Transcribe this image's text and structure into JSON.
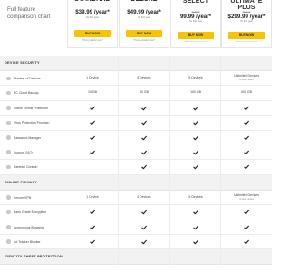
{
  "header": {
    "title_line1": "Full feature",
    "title_line2": "comparison chart"
  },
  "plans": [
    {
      "name": "STANDARD",
      "old_price": "",
      "price": "$39.99",
      "price_suffix": "/year*",
      "per": "for first year",
      "buy": "BUY NOW",
      "info": "*Pricing details below*",
      "name_faded": true
    },
    {
      "name": "DELUXE",
      "old_price": "",
      "price": "$49.99",
      "price_suffix": "/year*",
      "per": "for first year",
      "buy": "BUY NOW",
      "info": "*Pricing details below*",
      "name_faded": true
    },
    {
      "name": "SELECT",
      "old_price": "$149.99",
      "price": "99.99",
      "price_suffix": "/year*",
      "per": "for first year",
      "buy": "BUY NOW",
      "info": "*Pricing details below*",
      "name_faded": false
    },
    {
      "name": "ULTIMATE PLUS",
      "old_price": "$349.99",
      "price": "$299.99",
      "price_suffix": "/year*",
      "per": "for first year",
      "buy": "BUY NOW",
      "info": "*Pricing details below*",
      "name_faded": false
    }
  ],
  "sections": [
    {
      "label": "DEVICE SECURITY",
      "rows": [
        {
          "feature": "Number of Devices",
          "values": [
            "1 Device",
            "5 Devices",
            "5 Devices",
            "Unlimited Devices|Unless noted"
          ]
        },
        {
          "feature": "PC Cloud Backup",
          "values": [
            "10 GB",
            "50 GB",
            "100 GB",
            "500 GB"
          ]
        },
        {
          "feature": "Online Threat Protection",
          "values": [
            "check",
            "check",
            "check",
            "check"
          ]
        },
        {
          "feature": "Virus Protection Promise²",
          "values": [
            "check",
            "check",
            "check",
            "check"
          ]
        },
        {
          "feature": "Password Manager",
          "values": [
            "check",
            "check",
            "check",
            "check"
          ]
        },
        {
          "feature": "Support 24/7³",
          "values": [
            "check",
            "check",
            "check",
            "check"
          ]
        },
        {
          "feature": "Parental Control³",
          "values": [
            "",
            "check",
            "check",
            "check"
          ]
        }
      ]
    },
    {
      "label": "ONLINE PRIVACY",
      "rows": [
        {
          "feature": "Secure VPN",
          "values": [
            "1 Device",
            "5 Devices",
            "5 Devices",
            "Unlimited Devices|Unless noted"
          ]
        },
        {
          "feature": "Bank Grade Encryption",
          "values": [
            "check",
            "check",
            "check",
            "check"
          ]
        },
        {
          "feature": "Anonymous Browsing",
          "values": [
            "check",
            "check",
            "check",
            "check"
          ]
        },
        {
          "feature": "Ad Tracker Blocker",
          "values": [
            "check",
            "check",
            "check",
            "check"
          ]
        }
      ]
    },
    {
      "label": "IDENTITY THEFT PROTECTION",
      "rows": []
    }
  ],
  "colors": {
    "accent": "#f6c400",
    "check": "#222222",
    "section_bg": "#f2f2f2"
  },
  "icons": {
    "feature_icon": "feature-dot-icon",
    "check_icon": "checkmark-icon"
  }
}
